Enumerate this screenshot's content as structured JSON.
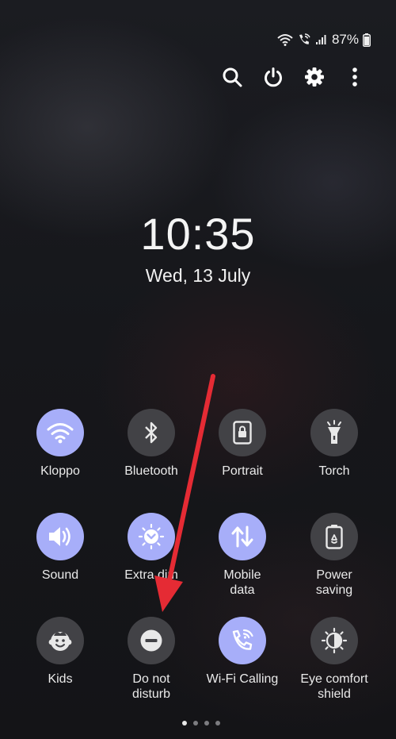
{
  "status_bar": {
    "battery_percent": "87%",
    "icons": [
      "wifi-icon",
      "wifi-calling-icon",
      "cell-signal-icon",
      "battery-icon"
    ]
  },
  "top_actions": [
    {
      "icon": "search-icon"
    },
    {
      "icon": "power-icon"
    },
    {
      "icon": "settings-icon"
    },
    {
      "icon": "more-icon"
    }
  ],
  "clock": {
    "time": "10:35",
    "date": "Wed, 13 July"
  },
  "tiles": [
    {
      "label": "Kloppo",
      "icon": "wifi-icon",
      "active": true
    },
    {
      "label": "Bluetooth",
      "icon": "bluetooth-icon",
      "active": false
    },
    {
      "label": "Portrait",
      "icon": "portrait-lock-icon",
      "active": false
    },
    {
      "label": "Torch",
      "icon": "torch-icon",
      "active": false
    },
    {
      "label": "Sound",
      "icon": "sound-icon",
      "active": true
    },
    {
      "label": "Extra dim",
      "icon": "extra-dim-icon",
      "active": true
    },
    {
      "label": "Mobile\ndata",
      "icon": "mobile-data-icon",
      "active": true
    },
    {
      "label": "Power\nsaving",
      "icon": "power-saving-icon",
      "active": false
    },
    {
      "label": "Kids",
      "icon": "kids-icon",
      "active": false
    },
    {
      "label": "Do not\ndisturb",
      "icon": "do-not-disturb-icon",
      "active": false
    },
    {
      "label": "Wi-Fi Calling",
      "icon": "wifi-calling-icon",
      "active": true
    },
    {
      "label": "Eye comfort\nshield",
      "icon": "eye-comfort-icon",
      "active": false
    }
  ],
  "pagination": {
    "pages": 4,
    "current": 1
  },
  "colors": {
    "active_tile": "#a7aef9",
    "inactive_tile": "#424246",
    "annotation_arrow": "#e52b34"
  }
}
